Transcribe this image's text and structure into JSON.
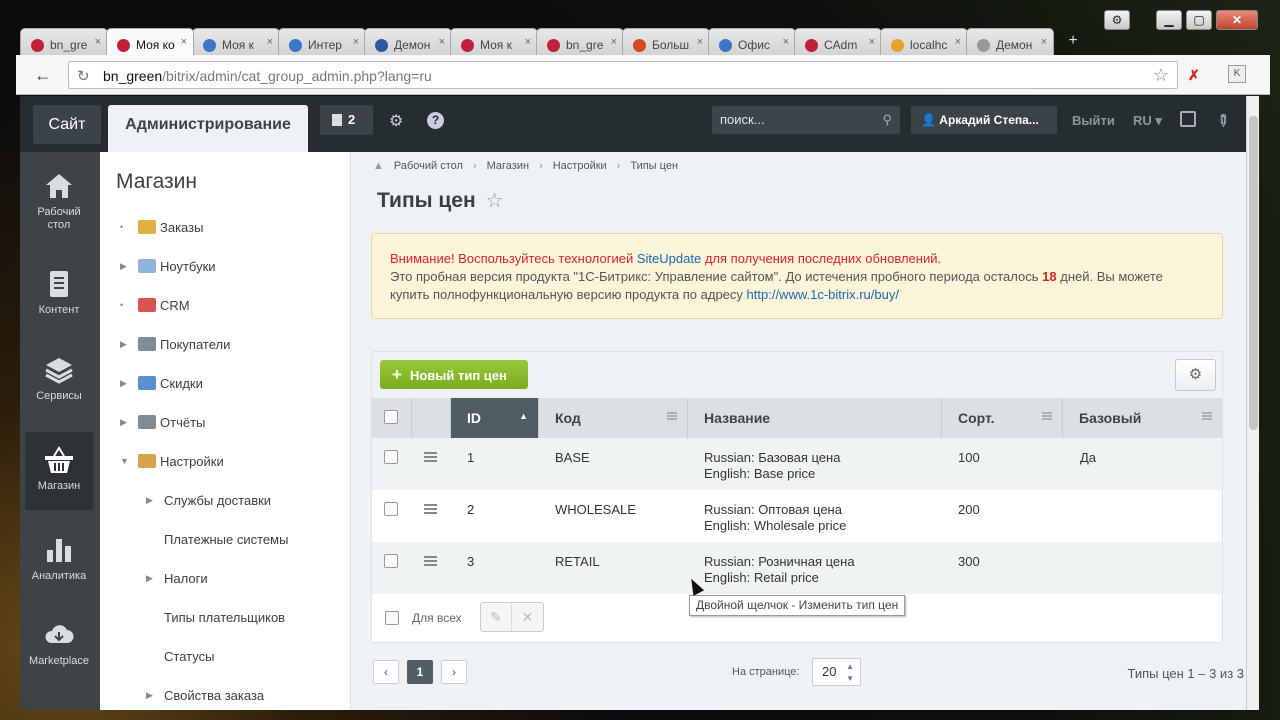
{
  "browser": {
    "tabs": [
      {
        "title": "bn_gre",
        "color": "#c0203a",
        "active": false
      },
      {
        "title": "Моя ко",
        "color": "#c0203a",
        "active": true
      },
      {
        "title": "Моя к",
        "color": "#3a77c9",
        "active": false
      },
      {
        "title": "Интер",
        "color": "#3a77c9",
        "active": false
      },
      {
        "title": "Демон",
        "color": "#2a5aa0",
        "active": false
      },
      {
        "title": "Моя к",
        "color": "#c0203a",
        "active": false
      },
      {
        "title": "bn_gre",
        "color": "#c0203a",
        "active": false
      },
      {
        "title": "Больш",
        "color": "#d9471f",
        "active": false
      },
      {
        "title": "Офис",
        "color": "#3a77c9",
        "active": false
      },
      {
        "title": "CAdm",
        "color": "#c0203a",
        "active": false
      },
      {
        "title": "localhc",
        "color": "#e4a42b",
        "active": false
      },
      {
        "title": "Демон",
        "color": "#999999",
        "active": false
      }
    ],
    "url_host": "bn_green",
    "url_path": "/bitrix/admin/cat_group_admin.php?lang=ru",
    "ext2_label": "K"
  },
  "header": {
    "site_btn": "Сайт",
    "admin_tab": "Администрирование",
    "notif_count": "2",
    "search_placeholder": "поиск...",
    "user_name": "Аркадий Степа...",
    "logout": "Выйти",
    "lang": "RU"
  },
  "rail": [
    {
      "label": "Рабочий стол",
      "icon": "home-icon"
    },
    {
      "label": "Контент",
      "icon": "document-icon"
    },
    {
      "label": "Сервисы",
      "icon": "layers-icon"
    },
    {
      "label": "Магазин",
      "icon": "basket-icon",
      "active": true
    },
    {
      "label": "Аналитика",
      "icon": "bar-chart-icon"
    },
    {
      "label": "Marketplace",
      "icon": "cloud-download-icon"
    }
  ],
  "menu": {
    "title": "Магазин",
    "items": [
      {
        "label": "Заказы",
        "arrow": "•",
        "icon_color": "#e0b042"
      },
      {
        "label": "Ноутбуки",
        "arrow": "▶",
        "icon_color": "#8fb6da"
      },
      {
        "label": "CRM",
        "arrow": "•",
        "icon_color": "#d9534f"
      },
      {
        "label": "Покупатели",
        "arrow": "▶",
        "icon_color": "#7e8c96"
      },
      {
        "label": "Скидки",
        "arrow": "▶",
        "icon_color": "#5b8fd0"
      },
      {
        "label": "Отчёты",
        "arrow": "▶",
        "icon_color": "#7e8c96"
      },
      {
        "label": "Настройки",
        "arrow": "▼",
        "icon_color": "#d8a24a"
      }
    ],
    "subitems": [
      {
        "label": "Службы доставки",
        "arrow": "▶"
      },
      {
        "label": "Платежные системы",
        "arrow": ""
      },
      {
        "label": "Налоги",
        "arrow": "▶"
      },
      {
        "label": "Типы плательщиков",
        "arrow": ""
      },
      {
        "label": "Статусы",
        "arrow": ""
      },
      {
        "label": "Свойства заказа",
        "arrow": "▶"
      }
    ]
  },
  "breadcrumbs": [
    "Рабочий стол",
    "Магазин",
    "Настройки",
    "Типы цен"
  ],
  "page_title": "Типы цен",
  "warning": {
    "line1_red": "Внимание! Воспользуйтесь технологией",
    "line1_link": "SiteUpdate",
    "line1_rest": "для получения последних обновлений.",
    "line2_pre": "Это пробная версия продукта \"1С-Битрикс: Управление сайтом\". До истечения пробного периода осталось",
    "days": "18",
    "line2_post": "дней. Вы можете",
    "line3_pre": "купить полнофункциональную версию продукта по адресу",
    "line3_link": "http://www.1c-bitrix.ru/buy/"
  },
  "grid": {
    "new_btn": "Новый тип цен",
    "columns": [
      "ID",
      "Код",
      "Название",
      "Сорт.",
      "Базовый"
    ],
    "rows": [
      {
        "id": "1",
        "code": "BASE",
        "name_ru": "Russian: Базовая цена",
        "name_en": "English: Base price",
        "sort": "100",
        "base": "Да"
      },
      {
        "id": "2",
        "code": "WHOLESALE",
        "name_ru": "Russian: Оптовая цена",
        "name_en": "English: Wholesale price",
        "sort": "200",
        "base": ""
      },
      {
        "id": "3",
        "code": "RETAIL",
        "name_ru": "Russian: Розничная цена",
        "name_en": "English: Retail price",
        "sort": "300",
        "base": ""
      }
    ],
    "for_all": "Для всех",
    "tooltip": "Двойной щелчок - Изменить тип цен"
  },
  "pager": {
    "current_page": "1",
    "per_page_label": "На странице:",
    "per_page_value": "20",
    "total": "Типы цен 1 – 3 из 3"
  }
}
